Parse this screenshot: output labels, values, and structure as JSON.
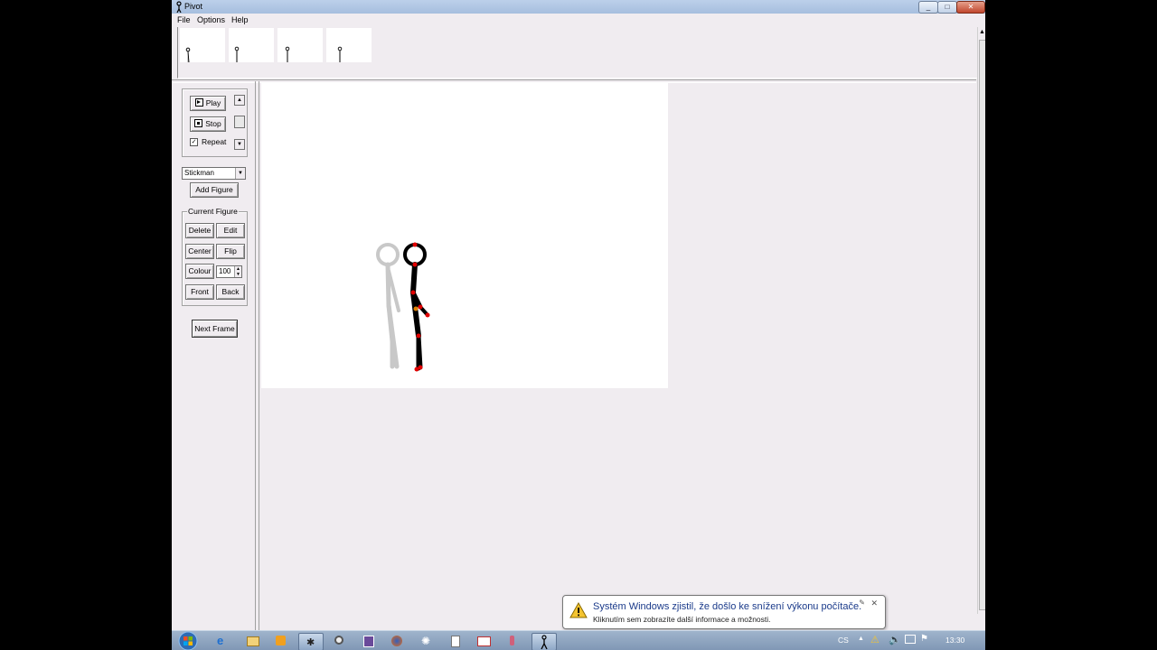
{
  "window": {
    "title": "Pivot",
    "buttons": [
      "_",
      "□",
      "✕"
    ]
  },
  "menu": [
    "File",
    "Options",
    "Help"
  ],
  "frames": {
    "count": 4
  },
  "playback": {
    "play_label": "Play",
    "stop_label": "Stop",
    "repeat_label": "Repeat",
    "repeat_checked": true
  },
  "figure_select": {
    "value": "Stickman"
  },
  "add_figure_label": "Add Figure",
  "current_figure": {
    "title": "Current Figure",
    "delete_label": "Delete",
    "edit_label": "Edit",
    "center_label": "Center",
    "flip_label": "Flip",
    "colour_label": "Colour",
    "colour_value": "100",
    "front_label": "Front",
    "back_label": "Back"
  },
  "next_frame_label": "Next Frame",
  "colors": {
    "figure": "#000000",
    "joint": "#e00000",
    "onion_skin": "#c8c8c8",
    "canvas": "#ffffff"
  },
  "notification": {
    "title": "Systém Windows zjistil, že došlo ke snížení výkonu počítače.",
    "text": "Kliknutím sem zobrazíte další informace a možnosti."
  },
  "taskbar": {
    "language": "CS",
    "time": "13:30"
  }
}
